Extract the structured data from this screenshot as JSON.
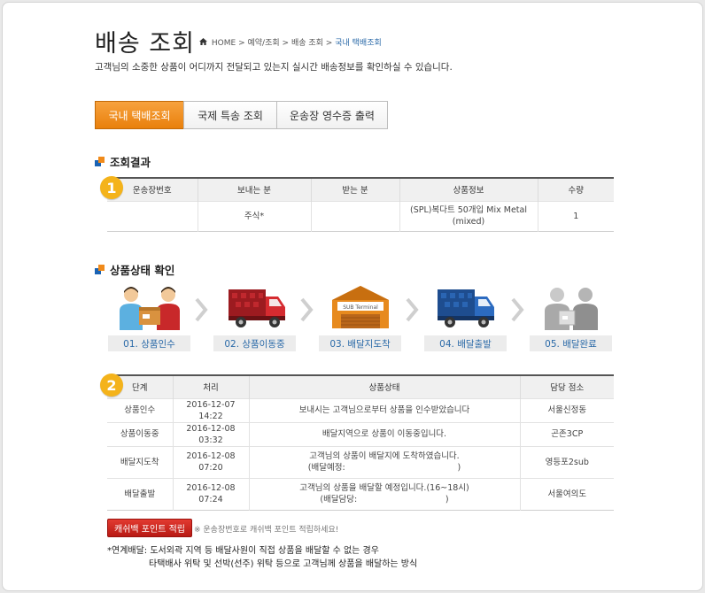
{
  "header": {
    "title": "배송 조회",
    "subtitle": "고객님의 소중한 상품이 어디까지 전달되고 있는지 실시간 배송정보를 확인하실 수 있습니다."
  },
  "breadcrumb": {
    "home": "HOME",
    "sep": ">",
    "items": [
      "예약/조회",
      "배송 조회"
    ],
    "current": "국내 택배조회"
  },
  "tabs": [
    {
      "label": "국내 택배조회",
      "active": true
    },
    {
      "label": "국제 특송 조회",
      "active": false
    },
    {
      "label": "운송장 영수증 출력",
      "active": false
    }
  ],
  "result_section": {
    "heading": "조회결과",
    "badge": "1",
    "columns": [
      "운송장번호",
      "보내는 분",
      "받는 분",
      "상품정보",
      "수량"
    ],
    "row": {
      "tracking_no": "",
      "sender": "주식*",
      "receiver": "",
      "product_line1": "(SPL)복다트 50개입 Mix Metal",
      "product_line2": "(mixed)",
      "quantity": "1"
    }
  },
  "status_section": {
    "heading": "상품상태 확인",
    "steps": [
      {
        "label": "01. 상품인수",
        "icon": "handover-icon"
      },
      {
        "label": "02. 상품이동중",
        "icon": "truck-red-icon"
      },
      {
        "label": "03. 배달지도착",
        "icon": "sub-terminal-icon"
      },
      {
        "label": "04. 배달출발",
        "icon": "truck-blue-icon"
      },
      {
        "label": "05. 배달완료",
        "icon": "delivered-icon"
      }
    ],
    "terminal_sign": "SUB Terminal"
  },
  "history_section": {
    "badge": "2",
    "columns": [
      "단계",
      "처리",
      "상품상태",
      "담당 점소"
    ],
    "rows": [
      {
        "stage": "상품인수",
        "time": "2016-12-07 14:22",
        "status1": "보내시는 고객님으로부터 상품을 인수받았습니다",
        "status2": "",
        "branch": "서울신정동"
      },
      {
        "stage": "상품이동중",
        "time": "2016-12-08 03:32",
        "status1": "배달지역으로 상품이 이동중입니다.",
        "status2": "",
        "branch": "곤존3CP"
      },
      {
        "stage": "배달지도착",
        "time": "2016-12-08 07:20",
        "status1": "고객님의 상품이 배달지에 도착하였습니다.",
        "status2": "(배달예정:                                          )",
        "branch": "영등포2sub"
      },
      {
        "stage": "배달출발",
        "time": "2016-12-08 07:24",
        "status1": "고객님의 상품을 배달할 예정입니다.(16~18시)",
        "status2": "(배달담당:                                 )",
        "branch": "서울여의도"
      }
    ]
  },
  "cashbag": {
    "button": "캐쉬백 포인트 적립",
    "note": "※ 운송장번호로 캐쉬백 포인트 적립하세요!"
  },
  "footnote": {
    "line1": "*연계배달: 도서외곽 지역 등 배달사원이 직접 상품을 배달할 수 없는 경우",
    "line2": "타택배사 위탁 및 선박(선주) 위탁 등으로 고객님께 상품을 배달하는 방식"
  },
  "colors": {
    "accent_orange": "#e9800c",
    "link_blue": "#2b6aa8",
    "badge_yellow": "#f4b31b",
    "cashbag_red": "#c8241c"
  }
}
